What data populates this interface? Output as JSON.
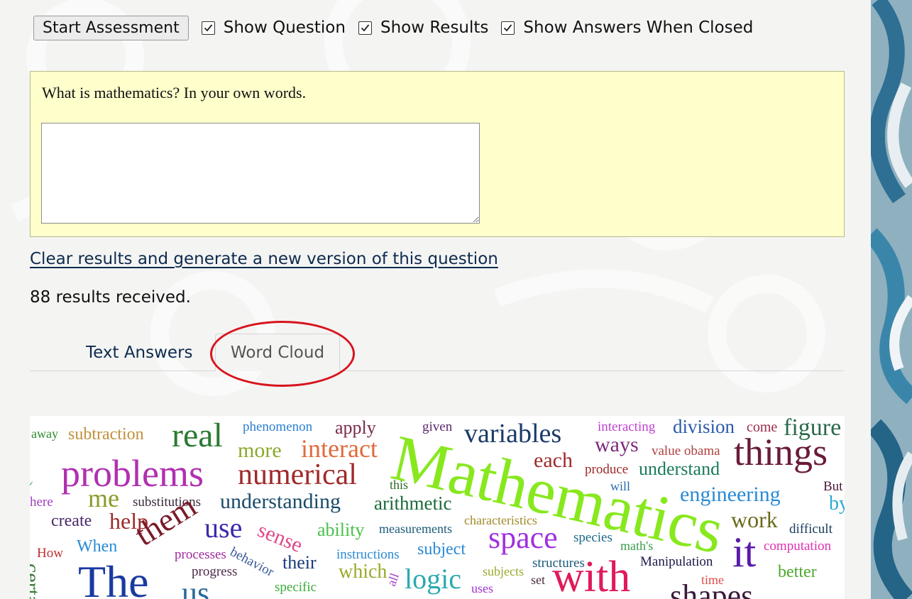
{
  "toolbar": {
    "start_label": "Start Assessment",
    "show_question_label": "Show Question",
    "show_question_checked": true,
    "show_results_label": "Show Results",
    "show_results_checked": true,
    "show_answers_label": "Show Answers When Closed",
    "show_answers_checked": true
  },
  "question": {
    "text": "What is mathematics? In your own words.",
    "answer_value": ""
  },
  "clear_link_label": "Clear results and generate a new version of this question",
  "results_text": "88 results received.",
  "tabs": [
    {
      "label": "Text Answers",
      "active": false
    },
    {
      "label": "Word Cloud",
      "active": true
    }
  ],
  "colors": {
    "question_bg": "#ffffcc",
    "link": "#0d2b4e",
    "highlight_ring": "#d8141c"
  },
  "word_cloud": {
    "words": [
      {
        "text": "away",
        "color": "#2e8b2e"
      },
      {
        "text": "subtraction",
        "color": "#c0903a"
      },
      {
        "text": "real",
        "color": "#2a7a32"
      },
      {
        "text": "phenomenon",
        "color": "#2a7fd4"
      },
      {
        "text": "apply",
        "color": "#7a2a4a"
      },
      {
        "text": "given",
        "color": "#5a2a6a"
      },
      {
        "text": "variables",
        "color": "#1a3a6a"
      },
      {
        "text": "interacting",
        "color": "#c040d0"
      },
      {
        "text": "division",
        "color": "#2a5aaa"
      },
      {
        "text": "come",
        "color": "#9a2a4a"
      },
      {
        "text": "figure",
        "color": "#2a6a4a"
      },
      {
        "text": "more",
        "color": "#8aaa2a"
      },
      {
        "text": "interact",
        "color": "#e06a3a"
      },
      {
        "text": "Mathematics",
        "color": "#88e81e"
      },
      {
        "text": "ways",
        "color": "#7a2a7a"
      },
      {
        "text": "value obama",
        "color": "#b04040"
      },
      {
        "text": "things",
        "color": "#6a1a3a"
      },
      {
        "text": "etc)",
        "color": "#3aaa8a"
      },
      {
        "text": "problems",
        "color": "#b030b0"
      },
      {
        "text": "numerical",
        "color": "#a02a2a"
      },
      {
        "text": "each",
        "color": "#a02a2a"
      },
      {
        "text": "produce",
        "color": "#a02a2a"
      },
      {
        "text": "understand",
        "color": "#1a7a5a"
      },
      {
        "text": "this",
        "color": "#2a6a2a"
      },
      {
        "text": "will",
        "color": "#2a6aaa"
      },
      {
        "text": "But",
        "color": "#4a1a3a"
      },
      {
        "text": "me",
        "color": "#8a9a2a"
      },
      {
        "text": "engineering",
        "color": "#2a8ad4"
      },
      {
        "text": "here",
        "color": "#a040c0"
      },
      {
        "text": "substitutions",
        "color": "#3a2a3a"
      },
      {
        "text": "understanding",
        "color": "#1a4a6a"
      },
      {
        "text": "arithmetic",
        "color": "#1a6a3a"
      },
      {
        "text": "by",
        "color": "#2aaad4"
      },
      {
        "text": "create",
        "color": "#4a2a6a"
      },
      {
        "text": "help",
        "color": "#a02a2a"
      },
      {
        "text": "characteristics",
        "color": "#a08a2a"
      },
      {
        "text": "work",
        "color": "#6a6a1a"
      },
      {
        "text": "difficult",
        "color": "#1a3a5a"
      },
      {
        "text": "them",
        "color": "#7a1a2a"
      },
      {
        "text": "use",
        "color": "#3a2aaa"
      },
      {
        "text": "sense",
        "color": "#e04a8a"
      },
      {
        "text": "ability",
        "color": "#4ac04a"
      },
      {
        "text": "measurements",
        "color": "#1a5a7a"
      },
      {
        "text": "space",
        "color": "#a030e0"
      },
      {
        "text": "species",
        "color": "#1a6a8a"
      },
      {
        "text": "it",
        "color": "#5a1aaa"
      },
      {
        "text": "computation",
        "color": "#e030b0"
      },
      {
        "text": "How",
        "color": "#c03030"
      },
      {
        "text": "When",
        "color": "#2a8ad4"
      },
      {
        "text": "processes",
        "color": "#a02aa0"
      },
      {
        "text": "behavior",
        "color": "#3a5a9a"
      },
      {
        "text": "their",
        "color": "#1a3a7a"
      },
      {
        "text": "instructions",
        "color": "#2a8ad4"
      },
      {
        "text": "subject",
        "color": "#2a8ad4"
      },
      {
        "text": "math's",
        "color": "#3a9a4a"
      },
      {
        "text": "structures",
        "color": "#1a5a7a"
      },
      {
        "text": "Manipulation",
        "color": "#1a1a4a"
      },
      {
        "text": "better",
        "color": "#4aaa2a"
      },
      {
        "text": "progress",
        "color": "#4a2a4a"
      },
      {
        "text": "which",
        "color": "#9aaa2a"
      },
      {
        "text": "logic",
        "color": "#2aaab0"
      },
      {
        "text": "subjects",
        "color": "#9aaa2a"
      },
      {
        "text": "with",
        "color": "#e01a5a"
      },
      {
        "text": "time",
        "color": "#e04a4a"
      },
      {
        "text": "set",
        "color": "#4a2a3a"
      },
      {
        "text": "uses",
        "color": "#a030d0"
      },
      {
        "text": "specific",
        "color": "#3aaa3a"
      },
      {
        "text": "The",
        "color": "#1a3aa0"
      },
      {
        "text": "us",
        "color": "#2a6a9a"
      },
      {
        "text": "shapes",
        "color": "#3a1a3a"
      },
      {
        "text": "certain",
        "color": "#3a7a3a"
      },
      {
        "text": "all",
        "color": "#a040c0"
      }
    ]
  }
}
